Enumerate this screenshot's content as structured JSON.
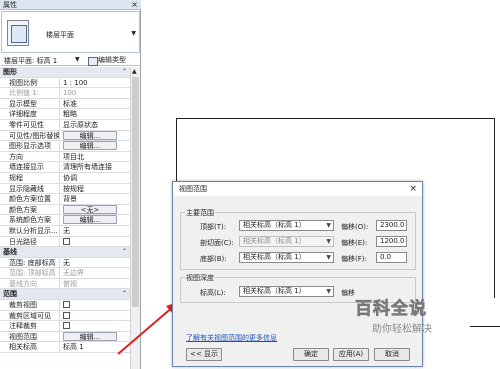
{
  "props": {
    "title": "属性",
    "close": "×",
    "type_name": "楼层平面",
    "instance_label": "楼层平面: 标高 1",
    "edit_type": "编辑类型",
    "rows": [
      {
        "kind": "sec",
        "k": "图形"
      },
      {
        "k": "视图比例",
        "v": "1 : 100"
      },
      {
        "k": "比例值 1:",
        "v": "100",
        "gray": true
      },
      {
        "k": "显示模型",
        "v": "标准"
      },
      {
        "k": "详细程度",
        "v": "粗略"
      },
      {
        "k": "零件可见性",
        "v": "显示原状态"
      },
      {
        "k": "可见性/图形替换",
        "btn": "编辑..."
      },
      {
        "k": "图形显示选项",
        "btn": "编辑..."
      },
      {
        "k": "方向",
        "v": "项目北"
      },
      {
        "k": "墙连接显示",
        "v": "清理所有墙连接"
      },
      {
        "k": "规程",
        "v": "协调"
      },
      {
        "k": "显示隐藏线",
        "v": "按规程"
      },
      {
        "k": "颜色方案位置",
        "v": "背景"
      },
      {
        "k": "颜色方案",
        "btn": "<无>"
      },
      {
        "k": "系统颜色方案",
        "btn": "编辑..."
      },
      {
        "k": "默认分析显示...",
        "v": "无"
      },
      {
        "k": "日光路径",
        "cb": true
      },
      {
        "kind": "sec",
        "k": "基线"
      },
      {
        "k": "范围: 底部标高",
        "v": "无"
      },
      {
        "k": "范围: 顶部标高",
        "v": "无边界",
        "gray": true
      },
      {
        "k": "基线方向",
        "v": "俯视",
        "gray": true
      },
      {
        "kind": "sec",
        "k": "范围"
      },
      {
        "k": "裁剪视图",
        "cb": true
      },
      {
        "k": "裁剪区域可见",
        "cb": true
      },
      {
        "k": "注释裁剪",
        "cb": true
      },
      {
        "k": "视图范围",
        "btn": "编辑..."
      },
      {
        "k": "相关标高",
        "v": "标高 1"
      }
    ]
  },
  "dialog": {
    "title": "视图范围",
    "close": "×",
    "main_range": "主要范围",
    "top_label": "顶部(T):",
    "top_select": "相关标高（标高 1）",
    "top_offset_label": "偏移(O):",
    "top_offset": "2300.0",
    "cut_label": "剖切面(C):",
    "cut_select": "相关标高（标高 1）",
    "cut_offset_label": "偏移(E):",
    "cut_offset": "1200.0",
    "bottom_label": "底部(B):",
    "bottom_select": "相关标高（标高 1）",
    "bottom_offset_label": "偏移(F):",
    "bottom_offset": "0.0",
    "depth_title": "视图深度",
    "level_label": "标高(L):",
    "level_select": "相关标高（标高 1）",
    "level_offset_label": "偏移",
    "link": "了解有关视图范围的更多信息",
    "show_btn": "<< 显示",
    "ok_btn": "确定",
    "apply_btn": "应用(A)",
    "cancel_btn": "取消"
  },
  "watermark": {
    "big": "百科全说",
    "small": "助你轻松解决"
  },
  "colors": {
    "arrow": "#e02020",
    "link": "#1a4fbd"
  }
}
